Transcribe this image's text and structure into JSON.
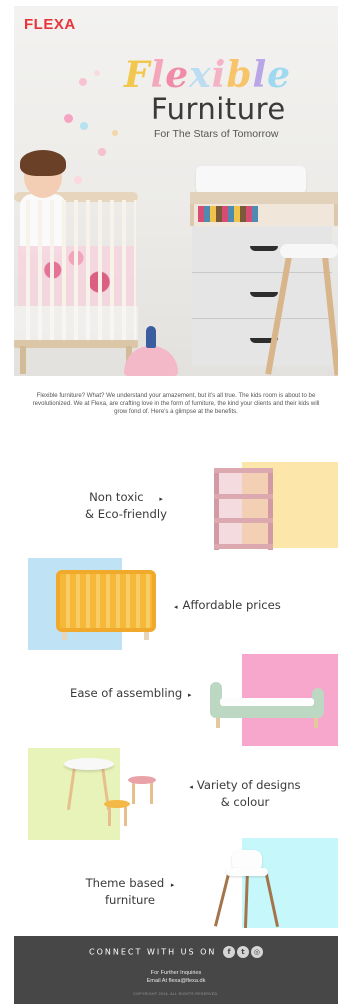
{
  "brand": {
    "logo": "FLEXA",
    "logo_color": "#e8353b"
  },
  "hero": {
    "headline_word": "Flexible",
    "headline_letter_colors": [
      "#f2c74e",
      "#f4a7bb",
      "#f28aa9",
      "#bcdcf2",
      "#f3b2c6",
      "#f8c46a",
      "#b8a6e6",
      "#9ed9f1"
    ],
    "headline_line2": "Furniture",
    "tagline": "For The Stars of Tomorrow"
  },
  "intro": {
    "text": "Flexible furniture? What? We understand your amazement, but it's all true. The kids room is about to be revolutionized. We at Flexa, are crafting love in the form of furniture, the kind your clients and their kids will grow fond of. Here's a glimpse at the benefits."
  },
  "features": [
    {
      "line1": "Non toxic",
      "line2": "& Eco-friendly",
      "arrow": "▸",
      "block_color": "#fde6a9",
      "image": "bookshelf"
    },
    {
      "line1": "Affordable prices",
      "line2": "",
      "arrow": "◂",
      "block_color": "#bfe2f5",
      "image": "crib"
    },
    {
      "line1": "Ease of assembling",
      "line2": "",
      "arrow": "▸",
      "block_color": "#f7a7cc",
      "image": "bed"
    },
    {
      "line1": "Variety of designs",
      "line2": "& colour",
      "arrow": "◂",
      "block_color": "#e7f3b8",
      "image": "table-and-stools"
    },
    {
      "line1": "Theme based",
      "line2": "furniture",
      "arrow": "▸",
      "block_color": "#c5f7fb",
      "image": "high-chair"
    }
  ],
  "footer": {
    "connect_label": "CONNECT WITH US ON",
    "social_icons": [
      "facebook-icon",
      "twitter-icon",
      "instagram-icon"
    ],
    "social_glyphs": [
      "f",
      "t",
      "◎"
    ],
    "inquiries_line1": "For Further Inquiries",
    "inquiries_line2": "Email At flexa@flexa.dk",
    "copyright": "COPYRIGHT 2016. ALL RIGHTS RESERVED.",
    "background": "#474747"
  }
}
